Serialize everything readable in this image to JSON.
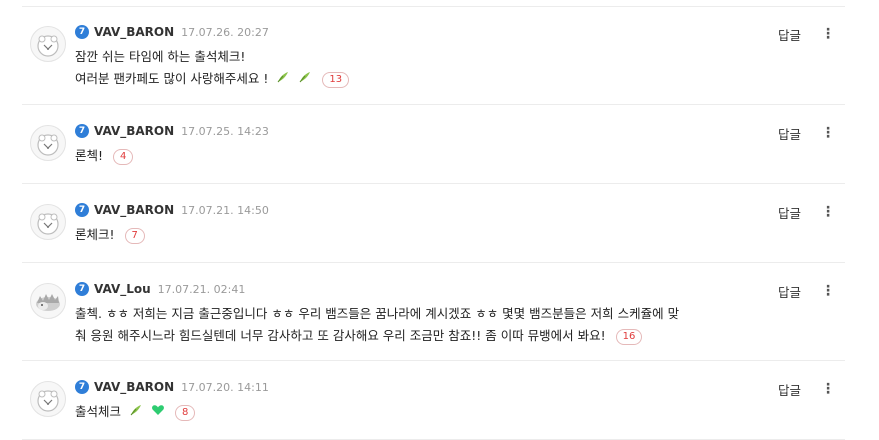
{
  "comments": [
    {
      "level": "7",
      "nickname": "VAV_BARON",
      "date": "17.07.26. 20:27",
      "lines": [
        "잠깐 쉬는 타임에 하는 출석체크!",
        "여러분 팬카페도 많이 사랑해주세요 !"
      ],
      "emoticons": [
        "leaf-emoticon",
        "leaf-emoticon"
      ],
      "reply_count": "13",
      "reply_label": "답글",
      "more_label": "⋮",
      "avatar": "sheep"
    },
    {
      "level": "7",
      "nickname": "VAV_BARON",
      "date": "17.07.25. 14:23",
      "lines": [
        "론첵!"
      ],
      "emoticons": [],
      "reply_count": "4",
      "reply_label": "답글",
      "more_label": "⋮",
      "avatar": "sheep"
    },
    {
      "level": "7",
      "nickname": "VAV_BARON",
      "date": "17.07.21. 14:50",
      "lines": [
        "론체크!"
      ],
      "emoticons": [],
      "reply_count": "7",
      "reply_label": "답글",
      "more_label": "⋮",
      "avatar": "sheep"
    },
    {
      "level": "7",
      "nickname": "VAV_Lou",
      "date": "17.07.21. 02:41",
      "lines": [
        "출첵. ㅎㅎ 저희는 지금 출근중입니다 ㅎㅎ 우리 뱀즈들은 꿈나라에 계시겠죠 ㅎㅎ 몇몇 뱀즈분들은 저희 스케쥴에 맞",
        "춰 응원 해주시느라 힘드실텐데 너무 감사하고 또 감사해요 우리 조금만 참죠!! 좀 이따 뮤뱅에서 봐요!"
      ],
      "emoticons": [],
      "reply_count": "16",
      "reply_label": "답글",
      "more_label": "⋮",
      "avatar": "hedgehog"
    },
    {
      "level": "7",
      "nickname": "VAV_BARON",
      "date": "17.07.20. 14:11",
      "lines": [
        "출석체크"
      ],
      "emoticons": [
        "leaf-emoticon",
        "heart-emoticon"
      ],
      "reply_count": "8",
      "reply_label": "답글",
      "more_label": "⋮",
      "avatar": "sheep"
    }
  ]
}
